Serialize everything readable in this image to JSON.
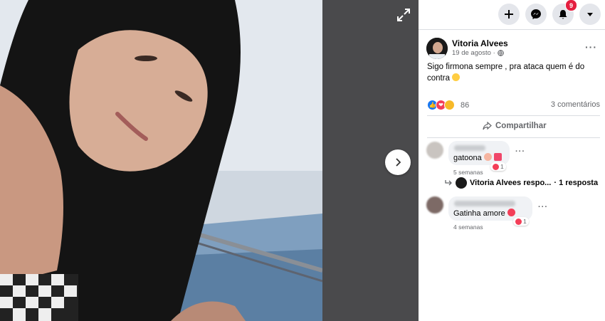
{
  "viewer": {
    "expand_icon": "expand-icon",
    "next_icon": "chevron-right-icon"
  },
  "topbar": {
    "buttons": [
      "plus-icon",
      "messenger-icon",
      "bell-icon",
      "caret-down-icon"
    ],
    "notifications_count": "9"
  },
  "post": {
    "author": "Vitoria Alvees",
    "date": "19 de agosto · ",
    "audience_icon": "globe-icon",
    "text": "Sigo firmona sempre , pra ataca quem é do contra",
    "reactions_count": "86",
    "comments_label": "3 comentários",
    "share_label": "Compartilhar"
  },
  "comments": [
    {
      "text": "gatoona",
      "time": "5 semanas",
      "likes": "1"
    },
    {
      "text": "Gatinha amore",
      "time": "4 semanas",
      "likes": "1"
    }
  ],
  "reply": {
    "author": "Vitoria Alvees respo...",
    "count": "· 1 resposta"
  },
  "colors": {
    "accent": "#1877f2",
    "badge": "#e41e3f",
    "muted": "#65676b"
  }
}
